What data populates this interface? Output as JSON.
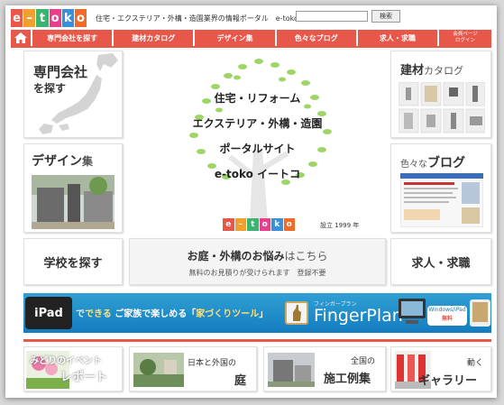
{
  "header": {
    "logo": [
      "e",
      "–",
      "t",
      "o",
      "k",
      "o"
    ],
    "tagline": "住宅・エクステリア・外構・造園業界の情報ポータル　e-toko イートコ",
    "search_label": "検索"
  },
  "nav": {
    "home_icon": "house-icon",
    "tabs": [
      "専門会社を探す",
      "建材カタログ",
      "デザイン集",
      "色々なブログ",
      "求人・求職"
    ],
    "small_tab_lines": [
      "会員ページ",
      "ログイン"
    ]
  },
  "tiles": {
    "company": {
      "line1": "専門会社",
      "line2": "を探す"
    },
    "design": {
      "title": "デザイン",
      "suffix": "集"
    },
    "school": "学校を探す",
    "materials": {
      "title": "建材",
      "suffix": "カタログ"
    },
    "blog": {
      "prefix": "色々な",
      "title": "ブログ"
    },
    "jobs": "求人・求職"
  },
  "center": {
    "lines": [
      "住宅・リフォーム",
      "エクステリア・外構・造園",
      "ポータルサイト",
      "e-toko イートコ"
    ],
    "founded": "設立 1999 年"
  },
  "consult": {
    "title_a": "お庭・外構のお悩み",
    "title_b": "はこちら",
    "subtitle": "無料のお見積りが受けられます　登録不要"
  },
  "banner": {
    "ipad": "iPad",
    "lead_a": "で",
    "lead_b": "できる",
    "text_a": "ご家族で楽しめる「",
    "highlight": "家づくりツール",
    "text_b": "」",
    "brand_kana": "フィンガープラン",
    "brand": "FingerPlan",
    "badge_top": "Windows/iPad",
    "badge_bottom": "無料"
  },
  "bottom": [
    {
      "top": "みどりのイベント",
      "bottom": "レポート"
    },
    {
      "top": "日本と外国の",
      "bottom": "庭"
    },
    {
      "top": "全国の",
      "bottom": "施工例集"
    },
    {
      "top": "動く",
      "bottom": "ギャラリー"
    }
  ],
  "colors": {
    "accent": "#e8584a",
    "logo": [
      "#e8584a",
      "#f0a030",
      "#3cb371",
      "#e83e8c",
      "#3a8fd8",
      "#f06a2a"
    ],
    "banner": "#1f8fcc",
    "brand_green": "#66bb33"
  }
}
